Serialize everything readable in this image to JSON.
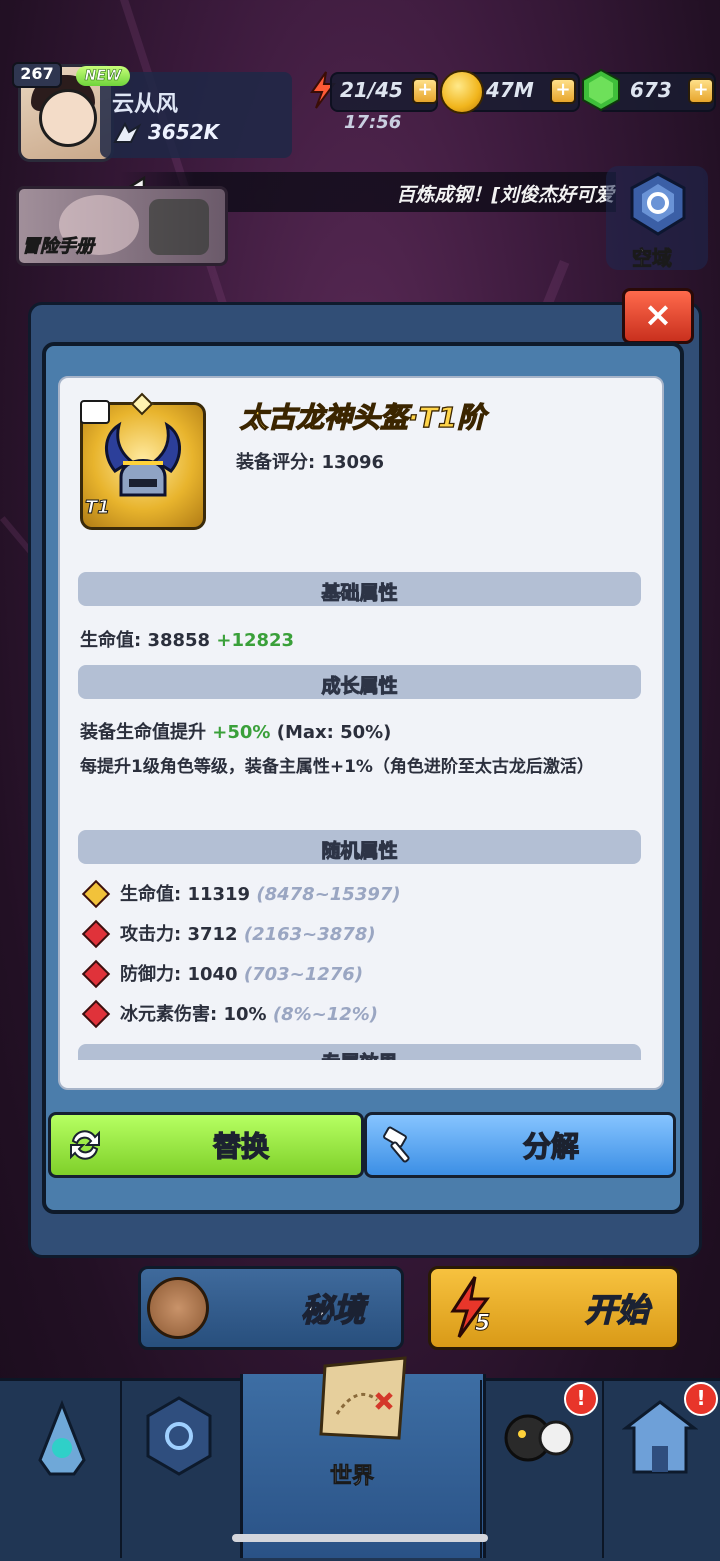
{
  "hud": {
    "level": "267",
    "new_badge": "NEW",
    "player_name": "云从风",
    "power": "3652K",
    "energy": "21/45",
    "gold": "47M",
    "gems": "673",
    "time": "17:56"
  },
  "announcement": "百炼成钢！[刘俊杰好可爱",
  "shortcuts": {
    "manual_label": "冒险手册",
    "skyzone_label": "空域"
  },
  "item": {
    "name": "太古龙神头盔·T1阶",
    "score_label": "装备评分: 13096",
    "tier_badge": "T1"
  },
  "sections": {
    "base": "基础属性",
    "growth": "成长属性",
    "random": "随机属性",
    "exclusive": "专属效果"
  },
  "base_stat": {
    "label": "生命值: 38858",
    "bonus": "+12823"
  },
  "growth_stats": {
    "line1_label": "装备生命值提升",
    "line1_value": "+50%",
    "line1_max": "(Max: 50%)",
    "line2": "每提升1级角色等级，装备主属性+1%（角色进阶至太古龙后激活）"
  },
  "random_stats": [
    {
      "label": "生命值: 11319",
      "range": "(8478~15397)",
      "color": "#f2c23a"
    },
    {
      "label": "攻击力: 3712",
      "range": "(2163~3878)",
      "color": "#e0323a"
    },
    {
      "label": "防御力: 1040",
      "range": "(703~1276)",
      "color": "#e0323a"
    },
    {
      "label": "冰元素伤害: 10%",
      "range": "(8%~12%)",
      "color": "#e0323a"
    }
  ],
  "buttons": {
    "replace": "替换",
    "decompose": "分解",
    "close": "×"
  },
  "lower": {
    "secret_realm": "秘境",
    "start": "开始",
    "start_cost": "5"
  },
  "tabs": {
    "world": "世界",
    "alert_mark": "!"
  }
}
